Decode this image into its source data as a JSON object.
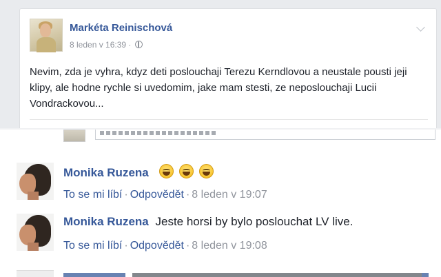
{
  "post": {
    "author": "Markéta Reinischová",
    "timestamp": "8 leden v 16:39",
    "audience_icon": "globe-icon",
    "text": "Nevim, zda je vyhra, kdyz deti posloucha­ji Terezu Kerndlovou a neustale pousti jeji klipy, ale hodne rychle si uvedomim, jake mam stesti, ze neposlouchaji Lucii Vondrackovou...",
    "menu_icon": "chevron-down-icon"
  },
  "comments": [
    {
      "author": "Monika Ruzena",
      "text": "",
      "emoji": [
        "laughing-face-icon",
        "laughing-face-icon",
        "laughing-face-icon"
      ],
      "like_label": "To se mi líbí",
      "reply_label": "Odpovědět",
      "timestamp": "8 leden v 19:07"
    },
    {
      "author": "Monika Ruzena",
      "text": "Jeste horsi by bylo poslouchat LV live.",
      "emoji": [],
      "like_label": "To se mi líbí",
      "reply_label": "Odpovědět",
      "timestamp": "8 leden v 19:08"
    }
  ],
  "colors": {
    "link": "#365899",
    "meta": "#90949c",
    "text": "#1d2129",
    "background": "#e9ebee"
  }
}
